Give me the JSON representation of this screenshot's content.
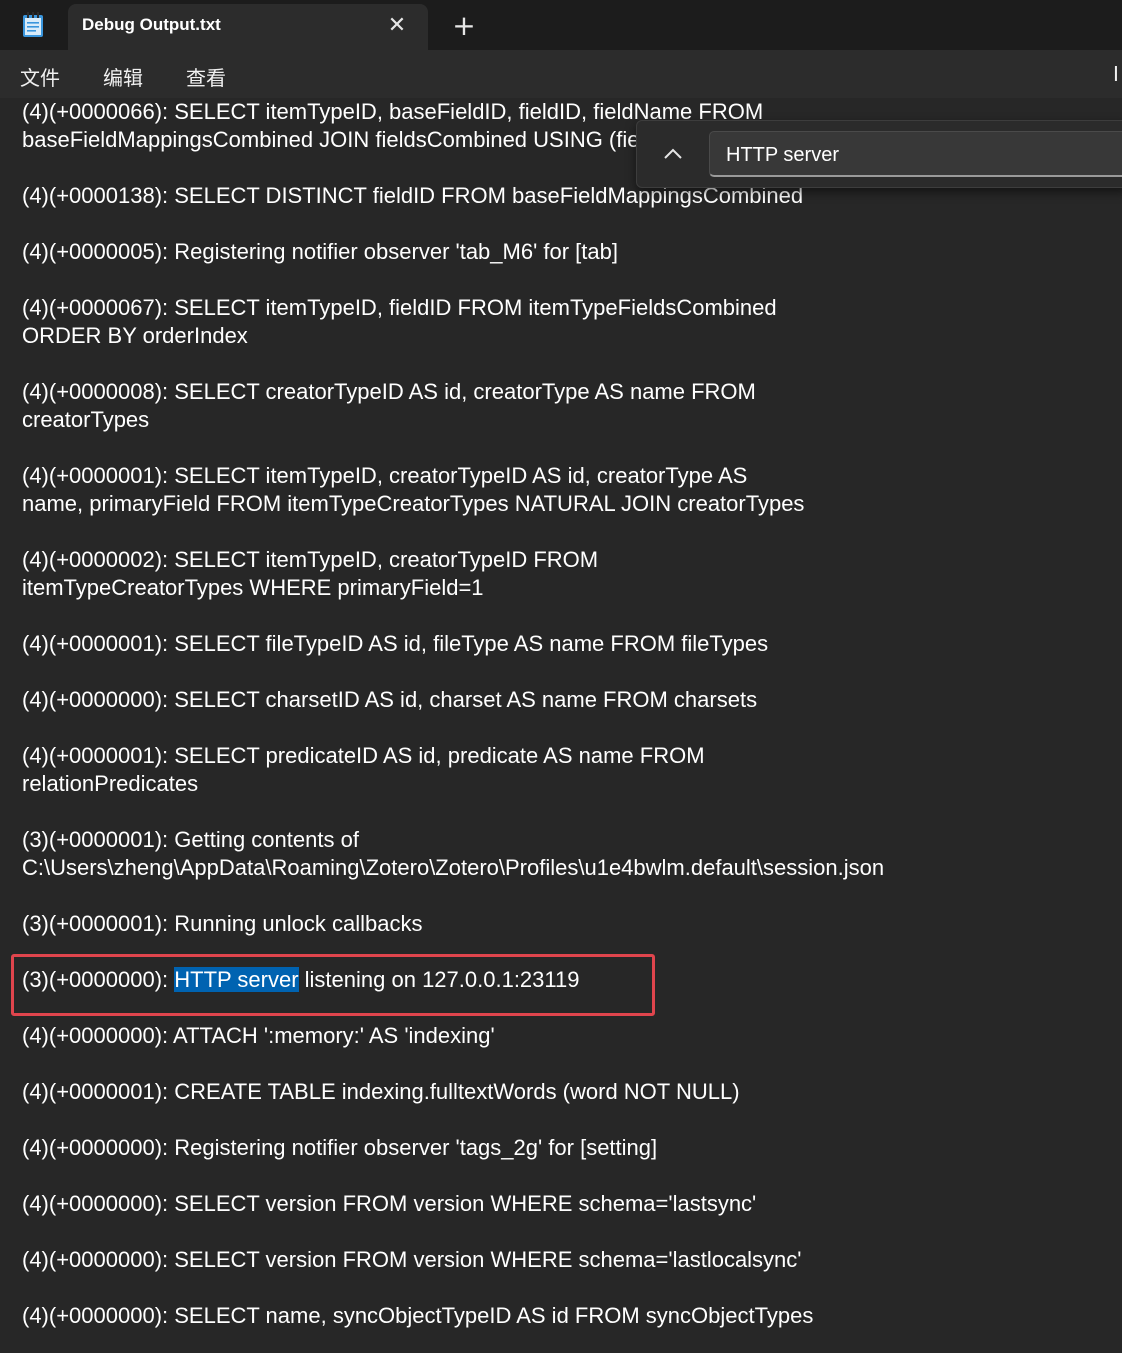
{
  "tab": {
    "title": "Debug Output.txt",
    "close_glyph": "✕",
    "new_tab_glyph": "+"
  },
  "menu": {
    "file": "文件",
    "edit": "编辑",
    "view": "查看",
    "right_partial": "I"
  },
  "find": {
    "query": "HTTP server",
    "toggle_glyph": "chevron-up-icon"
  },
  "lines": [
    {
      "text": "(4)(+0000066): SELECT itemTypeID, baseFieldID, fieldID, fieldName FROM"
    },
    {
      "text": "baseFieldMappingsCombined JOIN fieldsCombined USING (fieldID)"
    },
    {
      "text": "(4)(+0000138): SELECT DISTINCT fieldID FROM baseFieldMappingsCombined"
    },
    {
      "text": "(4)(+0000005): Registering notifier observer 'tab_M6' for [tab]"
    },
    {
      "text": "(4)(+0000067): SELECT itemTypeID, fieldID FROM itemTypeFieldsCombined"
    },
    {
      "text": "ORDER BY orderIndex"
    },
    {
      "text": "(4)(+0000008): SELECT creatorTypeID AS id, creatorType AS name FROM"
    },
    {
      "text": "creatorTypes"
    },
    {
      "text": "(4)(+0000001): SELECT itemTypeID, creatorTypeID AS id, creatorType AS"
    },
    {
      "text": "name, primaryField FROM itemTypeCreatorTypes NATURAL JOIN creatorTypes"
    },
    {
      "text": "(4)(+0000002): SELECT itemTypeID, creatorTypeID FROM"
    },
    {
      "text": "itemTypeCreatorTypes WHERE primaryField=1"
    },
    {
      "text": "(4)(+0000001): SELECT fileTypeID AS id, fileType AS name FROM fileTypes"
    },
    {
      "text": "(4)(+0000000): SELECT charsetID AS id, charset AS name FROM charsets"
    },
    {
      "text": "(4)(+0000001): SELECT predicateID AS id, predicate AS name FROM"
    },
    {
      "text": "relationPredicates"
    },
    {
      "text": "(3)(+0000001): Getting contents of"
    },
    {
      "text": "C:\\Users\\zheng\\AppData\\Roaming\\Zotero\\Zotero\\Profiles\\u1e4bwlm.default\\session.json"
    },
    {
      "text": "(3)(+0000001): Running unlock callbacks"
    },
    {
      "prefix": "(3)(+0000000): ",
      "match": "HTTP server",
      "suffix": " listening on 127.0.0.1:23119"
    },
    {
      "text": "(4)(+0000000): ATTACH ':memory:' AS 'indexing'"
    },
    {
      "text": "(4)(+0000001): CREATE TABLE indexing.fulltextWords (word NOT NULL)"
    },
    {
      "text": "(4)(+0000000): Registering notifier observer 'tags_2g' for [setting]"
    },
    {
      "text": "(4)(+0000000): SELECT version FROM version WHERE schema='lastsync'"
    },
    {
      "text": "(4)(+0000000): SELECT version FROM version WHERE schema='lastlocalsync'"
    },
    {
      "text": "(4)(+0000000): SELECT name, syncObjectTypeID AS id FROM syncObjectTypes"
    }
  ],
  "colors": {
    "background": "#272727",
    "selection": "#0063b1",
    "annotation_box": "#e0454d"
  }
}
